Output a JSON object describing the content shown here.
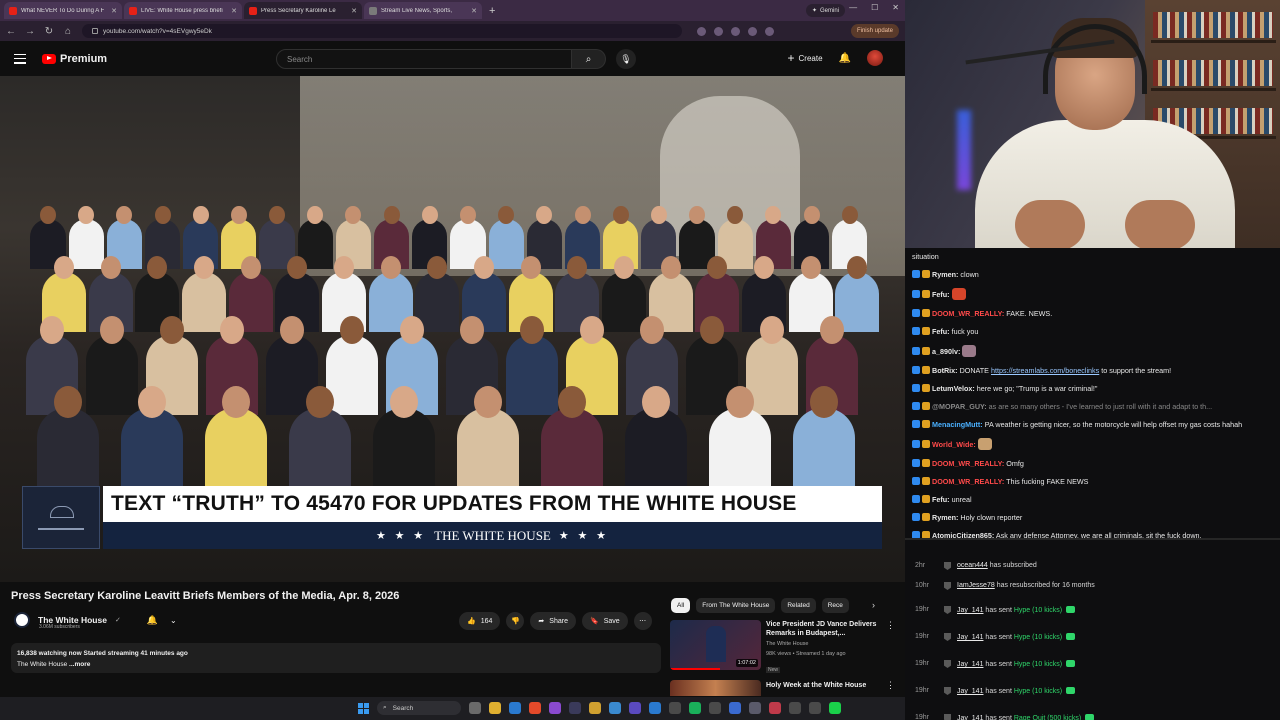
{
  "browser": {
    "tabs": [
      {
        "title": "What NEVER To Do During A F",
        "active": false
      },
      {
        "title": "LIVE: White House press briefi",
        "active": false
      },
      {
        "title": "Press Secretary Karoline Le",
        "active": true
      },
      {
        "title": "Stream Live News, Sports,",
        "active": false
      }
    ],
    "gemini_label": "Gemini",
    "url": "youtube.com/watch?v=4sEVgwy5eDk",
    "finish_update": "Finish update"
  },
  "youtube": {
    "brand": "Premium",
    "search_placeholder": "Search",
    "create_label": "Create"
  },
  "video": {
    "banner_text": "TEXT “TRUTH” TO 45470 FOR UPDATES FROM THE WHITE HOUSE",
    "banner_sub": "THE WHITE HOUSE",
    "banner_stars": "★ ★ ★",
    "title": "Press Secretary Karoline Leavitt Briefs Members of the Media, Apr. 8, 2026",
    "channel": "The White House",
    "subscribers": "3.06M subscribers",
    "likes": "164",
    "share_label": "Share",
    "save_label": "Save",
    "watching": "16,838 watching now",
    "started": "Started streaming 41 minutes ago",
    "desc_channel": "The White House",
    "more_label": "...more"
  },
  "related": {
    "chips": [
      "All",
      "From The White House",
      "Related",
      "Rece"
    ],
    "items": [
      {
        "title": "Vice President JD Vance Delivers Remarks in Budapest,...",
        "channel": "The White House",
        "meta": "98K views • Streamed 1 day ago",
        "duration": "1:07:02",
        "badge": "New"
      },
      {
        "title": "Holy Week at the White House",
        "channel": "",
        "meta": "",
        "duration": "",
        "badge": ""
      }
    ]
  },
  "taskbar": {
    "search_label": "Search"
  },
  "chat": {
    "messages": [
      {
        "user": "",
        "text": "situation",
        "user_color": "#e8e8e8"
      },
      {
        "user": "Rymen:",
        "text": "clown",
        "user_color": "#e8e8e8"
      },
      {
        "user": "Fefu:",
        "text": "",
        "user_color": "#e8e8e8",
        "emote": "#d6452a"
      },
      {
        "user": "DOOM_WR_REALLY:",
        "text": "FAKE. NEWS.",
        "user_color": "#ff4a4a"
      },
      {
        "user": "Fefu:",
        "text": "fuck you",
        "user_color": "#e8e8e8"
      },
      {
        "user": "a_890lv:",
        "text": "",
        "user_color": "#e8e8e8",
        "emote": "#9a7a8a"
      },
      {
        "user": "BotRix:",
        "text": "DONATE",
        "link": "https://streamlabs.com/boneclinks",
        "text2": "to support the stream!",
        "user_color": "#e8e8e8"
      },
      {
        "user": "LetumVelox:",
        "text": "here we go; \"Trump is a war criminal!\"",
        "user_color": "#e8e8e8"
      },
      {
        "user": "@MOPAR_GUY:",
        "text": "as are so many others - I've learned to just roll with it and adapt to th...",
        "user_color": "#888888",
        "dim": true
      },
      {
        "user": "MenacingMutt:",
        "text": "PA weather is getting nicer, so the motorcycle will help offset my gas costs",
        "text2": "hahah",
        "user_color": "#4ab0ff"
      },
      {
        "user": "World_Wide:",
        "text": "",
        "user_color": "#ff4a4a",
        "emote": "#c8a070"
      },
      {
        "user": "DOOM_WR_REALLY:",
        "text": "Omfg",
        "user_color": "#ff4a4a"
      },
      {
        "user": "DOOM_WR_REALLY:",
        "text": "This fucking FAKE NEWS",
        "user_color": "#ff4a4a"
      },
      {
        "user": "Fefu:",
        "text": "unreal",
        "user_color": "#e8e8e8"
      },
      {
        "user": "Rymen:",
        "text": "Holy clown reporter",
        "user_color": "#e8e8e8"
      },
      {
        "user": "AtomicCitizen865:",
        "text": "Ask any defense Attorney, we are all criminals, sit the fuck down.",
        "user_color": "#e8e8e8"
      }
    ]
  },
  "events": [
    {
      "time": "2hr",
      "name": "ocean444",
      "text": "has subscribed",
      "hype": ""
    },
    {
      "time": "10hr",
      "name": "IamJesse78",
      "text": "has resubscribed for 16 months",
      "hype": ""
    },
    {
      "time": "19hr",
      "name": "Jay_141",
      "text": "has sent",
      "hype": "Hype (10 kicks)"
    },
    {
      "time": "19hr",
      "name": "Jay_141",
      "text": "has sent",
      "hype": "Hype (10 kicks)"
    },
    {
      "time": "19hr",
      "name": "Jay_141",
      "text": "has sent",
      "hype": "Hype (10 kicks)"
    },
    {
      "time": "19hr",
      "name": "Jay_141",
      "text": "has sent",
      "hype": "Hype (10 kicks)"
    },
    {
      "time": "19hr",
      "name": "Jay_141",
      "text": "has sent",
      "hype": "Rage Quit (500 kicks)"
    }
  ],
  "colors": {
    "accent_red": "#ff0000",
    "hype_green": "#2fd66a",
    "banner_navy": "#14233f"
  }
}
